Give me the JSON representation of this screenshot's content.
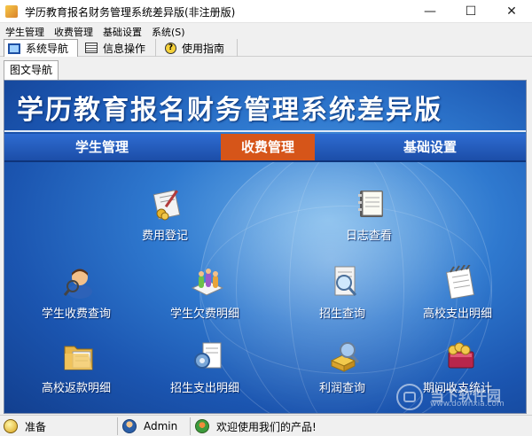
{
  "window": {
    "title": "学历教育报名财务管理系统差异版(非注册版)",
    "minimize_glyph": "—",
    "maximize_glyph": "☐",
    "close_glyph": "✕"
  },
  "menu": [
    {
      "label": "学生管理"
    },
    {
      "label": "收费管理"
    },
    {
      "label": "基础设置"
    },
    {
      "label": "系统(S)"
    }
  ],
  "toolbar": [
    {
      "label": "系统导航",
      "icon": "monitor-icon",
      "active": true
    },
    {
      "label": "信息操作",
      "icon": "document-icon",
      "active": false
    },
    {
      "label": "使用指南",
      "icon": "help-icon",
      "active": false
    }
  ],
  "panel_tab": {
    "label": "图文导航"
  },
  "banner": {
    "title": "学历教育报名财务管理系统差异版"
  },
  "nav": [
    {
      "label": "学生管理",
      "active": false
    },
    {
      "label": "收费管理",
      "active": true
    },
    {
      "label": "基础设置",
      "active": false
    }
  ],
  "tiles": [
    {
      "label": "费用登记",
      "icon": "fee-register-icon"
    },
    {
      "label": "日志查看",
      "icon": "log-book-icon"
    },
    {
      "label": "学生收费查询",
      "icon": "student-search-icon"
    },
    {
      "label": "学生欠费明细",
      "icon": "arrears-detail-icon"
    },
    {
      "label": "招生查询",
      "icon": "enrollment-search-icon"
    },
    {
      "label": "高校支出明细",
      "icon": "spending-notebook-icon"
    },
    {
      "label": "高校返款明细",
      "icon": "refund-folder-icon"
    },
    {
      "label": "招生支出明细",
      "icon": "settings-document-icon"
    },
    {
      "label": "利润查询",
      "icon": "profit-search-icon"
    },
    {
      "label": "期间收支统计",
      "icon": "period-stats-icon"
    }
  ],
  "watermark": {
    "text": "当下软件园",
    "url": "www.downxia.com"
  },
  "status": [
    {
      "label": "准备",
      "icon": "lightbulb-icon"
    },
    {
      "label": "Admin",
      "icon": "user-icon"
    },
    {
      "label": "欢迎使用我们的产品!",
      "icon": "people-icon"
    }
  ],
  "colors": {
    "accent_tab": "#d65519",
    "background_blue": "#1b55b0",
    "nav_blue": "#2e6bd1"
  }
}
